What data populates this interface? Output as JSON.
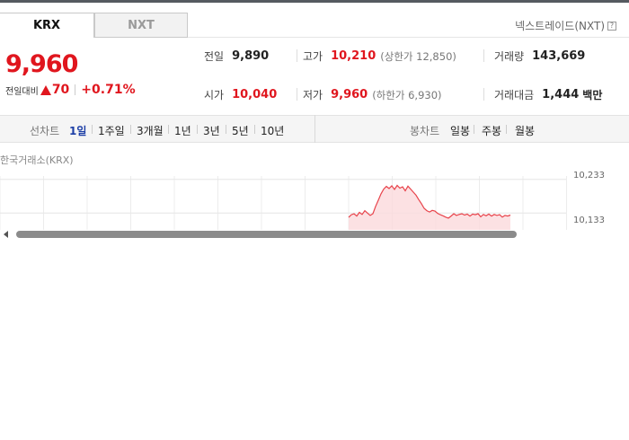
{
  "market_tabs": [
    {
      "label": "KRX",
      "active": true
    },
    {
      "label": "NXT",
      "active": false
    }
  ],
  "nxt_link": "넥스트레이드(NXT)",
  "help_glyph": "?",
  "price": {
    "current": "9,960",
    "change_label": "전일대비",
    "change_amount": "70",
    "change_percent": "+0.71%",
    "direction": "up",
    "color": "#e0161e"
  },
  "stats": {
    "prev_close": {
      "label": "전일",
      "value": "9,890"
    },
    "high": {
      "label": "고가",
      "value": "10,210",
      "sub": "(상한가 12,850)"
    },
    "volume": {
      "label": "거래량",
      "value": "143,669"
    },
    "open": {
      "label": "시가",
      "value": "10,040"
    },
    "low": {
      "label": "저가",
      "value": "9,960",
      "sub": "(하한가 6,930)"
    },
    "trade_value": {
      "label": "거래대금",
      "value": "1,444",
      "unit": "백만"
    }
  },
  "period_bar": {
    "line_chart_label": "선차트",
    "periods": [
      "1일",
      "1주일",
      "3개월",
      "1년",
      "3년",
      "5년",
      "10년"
    ],
    "active_period": "1일",
    "candle_chart_label": "봉차트",
    "candle_periods": [
      "일봉",
      "주봉",
      "월봉"
    ]
  },
  "chart_data": {
    "type": "line",
    "title": "한국거래소(KRX)",
    "y_ticks": [
      "10,233",
      "10,133"
    ],
    "ylim": [
      10083,
      10243
    ],
    "line_color": "#e8434b",
    "fill_color": "#fbdadc",
    "x": [
      0,
      1,
      2,
      3,
      4,
      5,
      6,
      7,
      8,
      9,
      10,
      11,
      12,
      13,
      14,
      15,
      16,
      17,
      18,
      19,
      20,
      21,
      22,
      23,
      24,
      25,
      26,
      27,
      28,
      29,
      30,
      31,
      32,
      33,
      34,
      35,
      36,
      37,
      38,
      39,
      40,
      41,
      42,
      43,
      44,
      45,
      46,
      47,
      48,
      49,
      50,
      51,
      52,
      53,
      54,
      55,
      56,
      57,
      58,
      59,
      60
    ],
    "y": [
      10120,
      10128,
      10131,
      10124,
      10135,
      10129,
      10140,
      10133,
      10126,
      10131,
      10153,
      10171,
      10190,
      10204,
      10212,
      10206,
      10214,
      10203,
      10215,
      10207,
      10211,
      10199,
      10213,
      10204,
      10195,
      10186,
      10173,
      10161,
      10147,
      10140,
      10136,
      10141,
      10139,
      10132,
      10128,
      10125,
      10121,
      10118,
      10124,
      10131,
      10126,
      10129,
      10131,
      10127,
      10130,
      10124,
      10130,
      10128,
      10131,
      10122,
      10129,
      10125,
      10130,
      10124,
      10129,
      10126,
      10128,
      10121,
      10126,
      10124,
      10127
    ]
  },
  "scroll": {
    "left_arrow": "scroll-left"
  }
}
